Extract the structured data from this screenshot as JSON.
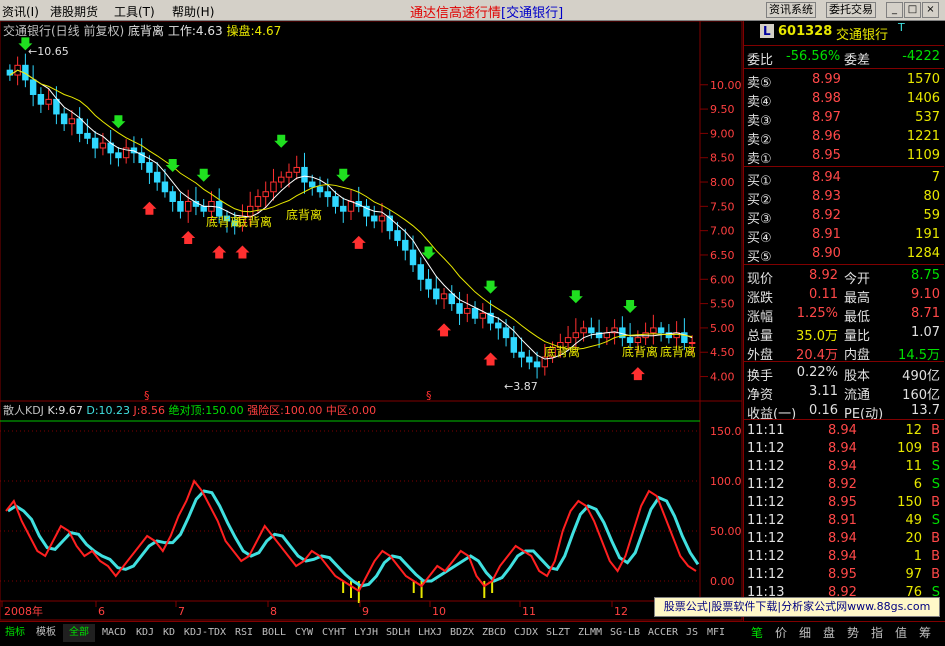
{
  "menu": {
    "items": [
      "资讯(I)",
      "港股期货",
      "工具(T)",
      "帮助(H)"
    ],
    "title_main": "通达信高速行情",
    "title_sub": "[交通银行]",
    "buttons": [
      "资讯系统",
      "委托交易"
    ],
    "window_controls": [
      "_",
      "□",
      "×"
    ]
  },
  "chart_header": {
    "stock": "交通银行(日线 前复权)",
    "indicator": "底背离",
    "work_label": "工作:",
    "work_value": "4.63",
    "op_label": "操盘:",
    "op_value": "4.67"
  },
  "annotations": {
    "high_label": "10.65",
    "low_label": "3.87",
    "divergence_labels": [
      "底背离",
      "底背离",
      "底背离",
      "底背离",
      "底背离",
      "底背离"
    ],
    "section_marks": [
      "§",
      "§"
    ]
  },
  "price_axis": [
    "10.00",
    "9.50",
    "9.00",
    "8.50",
    "8.00",
    "7.50",
    "7.00",
    "6.50",
    "6.00",
    "5.50",
    "5.00",
    "4.50",
    "4.00"
  ],
  "kdj_header": {
    "name": "散人KDJ",
    "k": "K:9.67",
    "d": "D:10.23",
    "j": "J:8.56",
    "top": "绝对顶:150.00",
    "risk": "强险区:100.00",
    "mid": "中区:0.00"
  },
  "kdj_axis": [
    "150.0",
    "100.0",
    "50.00",
    "0.00"
  ],
  "date_axis": [
    "2008年",
    "6",
    "7",
    "8",
    "9",
    "10",
    "11",
    "12"
  ],
  "quote": {
    "code": "601328",
    "name": "交通银行",
    "flag": "T",
    "wb_label": "委比",
    "wb_value": "-56.56%",
    "wc_label": "委差",
    "wc_value": "-4222",
    "asks": [
      {
        "label": "卖⑤",
        "price": "8.99",
        "vol": "1570"
      },
      {
        "label": "卖④",
        "price": "8.98",
        "vol": "1406"
      },
      {
        "label": "卖③",
        "price": "8.97",
        "vol": "537"
      },
      {
        "label": "卖②",
        "price": "8.96",
        "vol": "1221"
      },
      {
        "label": "卖①",
        "price": "8.95",
        "vol": "1109"
      }
    ],
    "bids": [
      {
        "label": "买①",
        "price": "8.94",
        "vol": "7"
      },
      {
        "label": "买②",
        "price": "8.93",
        "vol": "80"
      },
      {
        "label": "买③",
        "price": "8.92",
        "vol": "59"
      },
      {
        "label": "买④",
        "price": "8.91",
        "vol": "191"
      },
      {
        "label": "买⑤",
        "price": "8.90",
        "vol": "1284"
      }
    ],
    "stats": [
      {
        "l1": "现价",
        "v1": "8.92",
        "l2": "今开",
        "v2": "8.75"
      },
      {
        "l1": "涨跌",
        "v1": "0.11",
        "l2": "最高",
        "v2": "9.10"
      },
      {
        "l1": "涨幅",
        "v1": "1.25%",
        "l2": "最低",
        "v2": "8.71"
      },
      {
        "l1": "总量",
        "v1": "35.0万",
        "l2": "量比",
        "v2": "1.07"
      },
      {
        "l1": "外盘",
        "v1": "20.4万",
        "l2": "内盘",
        "v2": "14.5万"
      }
    ],
    "stats2": [
      {
        "l1": "换手",
        "v1": "0.22%",
        "l2": "股本",
        "v2": "490亿"
      },
      {
        "l1": "净资",
        "v1": "3.11",
        "l2": "流通",
        "v2": "160亿"
      },
      {
        "l1": "收益(一)",
        "v1": "0.16",
        "l2": "PE(动)",
        "v2": "13.7"
      }
    ],
    "ticks": [
      {
        "time": "11:11",
        "price": "8.94",
        "vol": "12",
        "side": "B"
      },
      {
        "time": "11:12",
        "price": "8.94",
        "vol": "109",
        "side": "B"
      },
      {
        "time": "11:12",
        "price": "8.94",
        "vol": "11",
        "side": "S"
      },
      {
        "time": "11:12",
        "price": "8.92",
        "vol": "6",
        "side": "S"
      },
      {
        "time": "11:12",
        "price": "8.95",
        "vol": "150",
        "side": "B"
      },
      {
        "time": "11:12",
        "price": "8.91",
        "vol": "49",
        "side": "S"
      },
      {
        "time": "11:12",
        "price": "8.94",
        "vol": "20",
        "side": "B"
      },
      {
        "time": "11:12",
        "price": "8.94",
        "vol": "1",
        "side": "B"
      },
      {
        "time": "11:12",
        "price": "8.95",
        "vol": "97",
        "side": "B"
      },
      {
        "time": "11:13",
        "price": "8.92",
        "vol": "76",
        "side": "S"
      }
    ]
  },
  "ad_text": "股票公式|股票软件下载|分析家公式网www.88gs.com",
  "bottom_tabs": [
    "指标",
    "模板",
    "全部",
    "MACD",
    "KDJ",
    "KD",
    "KDJ-TDX",
    "RSI",
    "BOLL",
    "CYW",
    "CYHT",
    "LYJH",
    "SDLH",
    "LHXJ",
    "BDZX",
    "ZBCD",
    "CJDX",
    "SLZT",
    "ZLMM",
    "SG-LB",
    "ACCER",
    "JS",
    "MFI"
  ],
  "panel_tabs": [
    "笔",
    "价",
    "细",
    "盘",
    "势",
    "指",
    "值",
    "筹"
  ],
  "colors": {
    "up": "#ff3030",
    "down": "#30d8ff",
    "ma1": "#ffffff",
    "ma2": "#e8e800",
    "k": "#ff2020",
    "d": "#40e0e0",
    "frame": "#800000"
  },
  "chart_data": {
    "type": "candlestick",
    "close_series": [
      10.2,
      10.4,
      10.1,
      9.8,
      9.6,
      9.7,
      9.4,
      9.2,
      9.3,
      9.0,
      8.9,
      8.7,
      8.8,
      8.6,
      8.5,
      8.7,
      8.6,
      8.4,
      8.2,
      8.0,
      7.8,
      7.6,
      7.4,
      7.6,
      7.5,
      7.4,
      7.6,
      7.3,
      7.2,
      7.1,
      7.3,
      7.5,
      7.7,
      7.8,
      8.0,
      8.1,
      8.2,
      8.3,
      8.0,
      7.9,
      7.8,
      7.7,
      7.5,
      7.4,
      7.6,
      7.5,
      7.3,
      7.2,
      7.3,
      7.0,
      6.8,
      6.6,
      6.3,
      6.0,
      5.8,
      5.6,
      5.7,
      5.5,
      5.3,
      5.4,
      5.2,
      5.3,
      5.1,
      5.0,
      4.8,
      4.5,
      4.4,
      4.3,
      4.2,
      4.4,
      4.6,
      4.7,
      4.8,
      4.9,
      5.0,
      4.9,
      4.8,
      4.9,
      5.0,
      4.8,
      4.7,
      4.8,
      4.9,
      5.0,
      4.9,
      4.8,
      4.9,
      4.7,
      4.7
    ],
    "k_series": [
      70,
      80,
      60,
      45,
      30,
      25,
      40,
      55,
      50,
      35,
      25,
      30,
      20,
      15,
      5,
      15,
      25,
      35,
      45,
      40,
      30,
      45,
      65,
      80,
      100,
      90,
      75,
      60,
      40,
      30,
      20,
      25,
      40,
      55,
      45,
      35,
      25,
      15,
      20,
      30,
      25,
      15,
      5,
      0,
      -5,
      -10,
      5,
      20,
      30,
      25,
      15,
      5,
      0,
      -5,
      5,
      15,
      10,
      20,
      30,
      25,
      5,
      -5,
      0,
      15,
      25,
      35,
      30,
      25,
      10,
      5,
      20,
      50,
      70,
      80,
      75,
      60,
      40,
      20,
      10,
      25,
      50,
      75,
      90,
      85,
      65,
      45,
      25,
      15,
      10
    ],
    "ylim": [
      3.6,
      10.9
    ],
    "kdj_ylim": [
      -20,
      160
    ]
  }
}
